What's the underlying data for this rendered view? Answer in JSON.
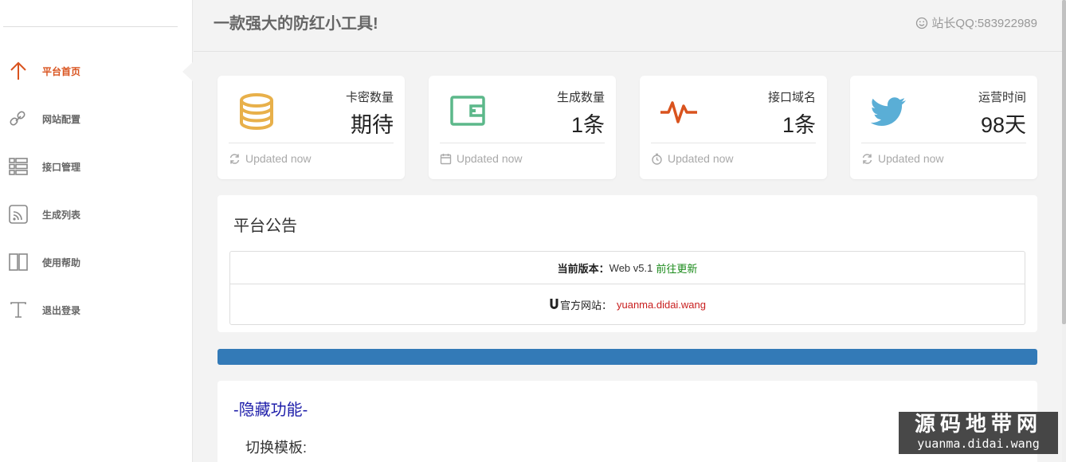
{
  "header": {
    "title": "一款强大的防红小工具!",
    "qq": "站长QQ:583922989"
  },
  "sidebar": {
    "items": [
      {
        "label": "平台首页",
        "icon": "arrow-up-icon"
      },
      {
        "label": "网站配置",
        "icon": "link-icon"
      },
      {
        "label": "接口管理",
        "icon": "list-icon"
      },
      {
        "label": "生成列表",
        "icon": "rss-icon"
      },
      {
        "label": "使用帮助",
        "icon": "book-icon"
      },
      {
        "label": "退出登录",
        "icon": "text-icon"
      }
    ]
  },
  "cards": [
    {
      "name": "卡密数量",
      "value": "期待",
      "foot": "Updated now",
      "icon": "coins-icon",
      "foot_icon": "refresh-icon",
      "color": "#e8b04a"
    },
    {
      "name": "生成数量",
      "value": "1条",
      "foot": "Updated now",
      "icon": "wallet-icon",
      "foot_icon": "calendar-icon",
      "color": "#5cb88a"
    },
    {
      "name": "接口域名",
      "value": "1条",
      "foot": "Updated now",
      "icon": "pulse-icon",
      "foot_icon": "stopwatch-icon",
      "color": "#d9531e"
    },
    {
      "name": "运营时间",
      "value": "98天",
      "foot": "Updated now",
      "icon": "twitter-icon",
      "foot_icon": "refresh-icon",
      "color": "#5aaed6"
    }
  ],
  "notice": {
    "title": "平台公告",
    "version_label": "当前版本：",
    "version_value": "Web v5.1",
    "update_link": "前往更新",
    "site_label": "官方网站：",
    "site_link": "yuanma.didai.wang"
  },
  "hidden": {
    "title": "-隐藏功能-",
    "switch_template": "切换模板:"
  },
  "watermark": {
    "line1": "源码地带网",
    "line2": "yuanma.didai.wang"
  }
}
